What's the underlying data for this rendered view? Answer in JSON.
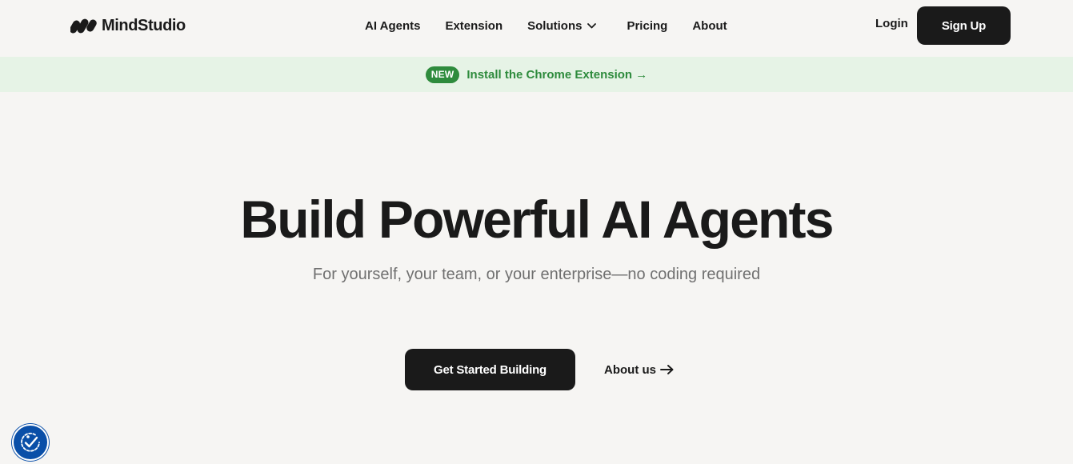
{
  "header": {
    "brand": "MindStudio",
    "nav": [
      {
        "label": "AI Agents"
      },
      {
        "label": "Extension"
      },
      {
        "label": "Solutions",
        "has_dropdown": true
      },
      {
        "label": "Pricing"
      },
      {
        "label": "About"
      }
    ],
    "login_label": "Login",
    "signup_label": "Sign Up"
  },
  "banner": {
    "badge": "NEW",
    "link_text": "Install the Chrome Extension →"
  },
  "hero": {
    "title": "Build Powerful AI Agents",
    "subtitle": "For yourself, your team, or your enterprise—no coding required",
    "cta_label": "Get Started Building",
    "about_label": "About us"
  },
  "icons": {
    "logo": "mindstudio-logo-icon",
    "dropdown": "chevron-down-icon",
    "arrow": "arrow-right-icon",
    "accessibility": "accessibility-icon"
  },
  "colors": {
    "background": "#f6f5f3",
    "text": "#1a1a1a",
    "muted": "#707070",
    "banner_bg": "#e6f3e6",
    "banner_accent": "#2e8b3d",
    "button": "#1a1a1a",
    "accessibility": "#0a4fa8"
  }
}
